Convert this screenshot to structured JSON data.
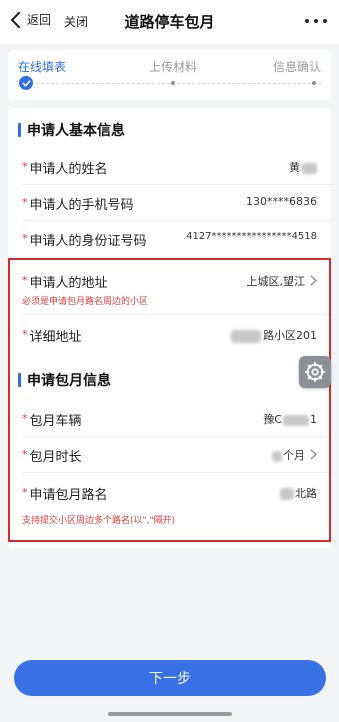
{
  "navbar": {
    "back_label": "返回",
    "close_label": "关闭",
    "title": "道路停车包月",
    "more_icon": "more-dots-icon"
  },
  "steps": [
    {
      "label": "在线填表",
      "state": "done"
    },
    {
      "label": "上传材料",
      "state": "pending"
    },
    {
      "label": "信息确认",
      "state": "pending"
    }
  ],
  "applicant_section": {
    "title": "申请人基本信息",
    "name_label": "申请人的姓名",
    "name_value": "黄",
    "phone_label": "申请人的手机号码",
    "phone_value": "130****6836",
    "id_label": "申请人的身份证号码",
    "id_value": "4127****************4518",
    "address_label": "申请人的地址",
    "address_value": "上城区,望江",
    "address_hint": "必须是申请包月路名周边的小区",
    "detail_label": "详细地址",
    "detail_value": "路小区201"
  },
  "monthly_section": {
    "title": "申请包月信息",
    "vehicle_label": "包月车辆",
    "vehicle_value_prefix": "豫C",
    "vehicle_value_suffix": "1",
    "duration_label": "包月时长",
    "duration_value": "个月",
    "road_label": "申请包月路名",
    "road_value": "北路",
    "road_hint": "支持提交小区周边多个路名(以\",\"隔开)"
  },
  "next_button": "下一步",
  "colors": {
    "accent": "#2f6de0",
    "required": "#e23b3b",
    "button": "#3a70e6",
    "highlight": "#d12b2b"
  }
}
